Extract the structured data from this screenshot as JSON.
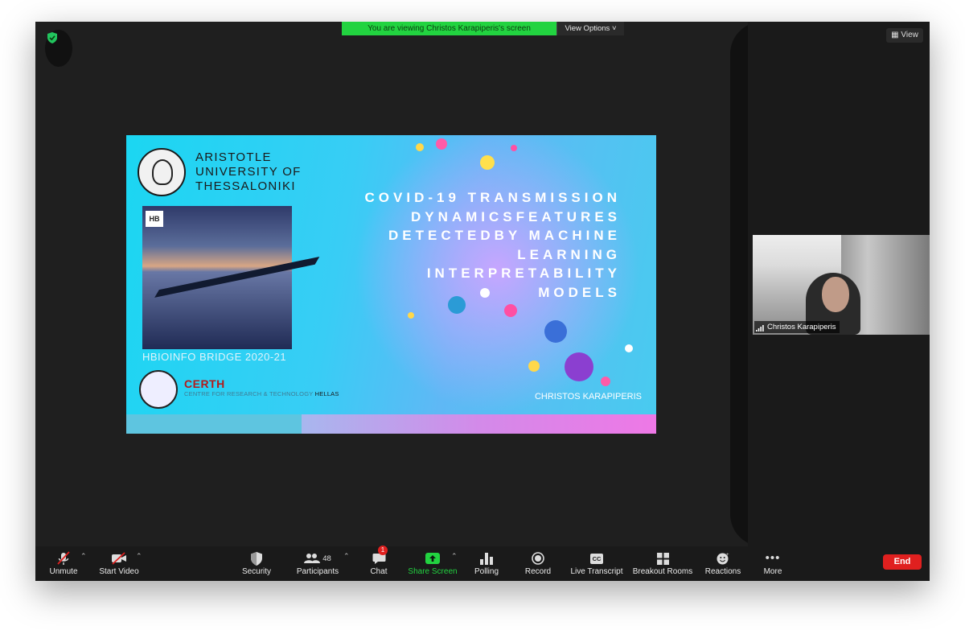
{
  "banner": {
    "text": "You are viewing Christos Karapiperis's screen",
    "view_options": "View Options ˅"
  },
  "view_button": "View",
  "slide": {
    "university": [
      "ARISTOTLE",
      "UNIVERSITY OF",
      "THESSALONIKI"
    ],
    "hb_logo": "HB",
    "photo_caption": "HBIOINFO BRIDGE 2020-21",
    "certh": "CERTH",
    "certh_sub_a": "CENTRE FOR RESEARCH & TECHNOLOGY",
    "certh_sub_b": "HELLAS",
    "title_lines": [
      "COVID-19 TRANSMISSION",
      "DYNAMICSFEATURES",
      "DETECTEDBY MACHINE",
      "LEARNING",
      "INTERPRETABILITY",
      "MODELS"
    ],
    "author": "CHRISTOS KARAPIPERIS"
  },
  "participant": {
    "name": "Christos Karapiperis"
  },
  "toolbar": {
    "unmute": "Unmute",
    "start_video": "Start Video",
    "security": "Security",
    "participants": "Participants",
    "participants_count": "48",
    "chat": "Chat",
    "chat_badge": "1",
    "share_screen": "Share Screen",
    "polling": "Polling",
    "record": "Record",
    "live_transcript": "Live Transcript",
    "cc": "CC",
    "breakout_rooms": "Breakout Rooms",
    "reactions": "Reactions",
    "more": "More",
    "end": "End"
  },
  "colors": {
    "banner": "#22d340",
    "end": "#e0201f",
    "share": "#22d340"
  }
}
